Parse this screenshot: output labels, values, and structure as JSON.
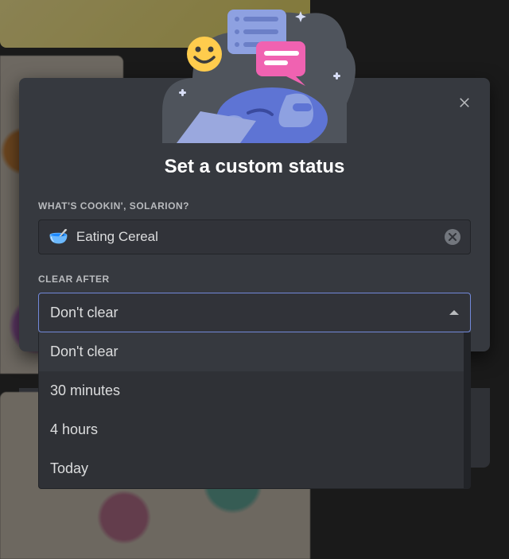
{
  "modal": {
    "title": "Set a custom status",
    "status_field": {
      "label": "WHAT'S COOKIN', SOLARION?",
      "emoji": "🥣",
      "value": "Eating Cereal"
    },
    "clear_after": {
      "label": "CLEAR AFTER",
      "selected": "Don't clear",
      "options": [
        "Don't clear",
        "30 minutes",
        "4 hours",
        "Today"
      ]
    }
  }
}
